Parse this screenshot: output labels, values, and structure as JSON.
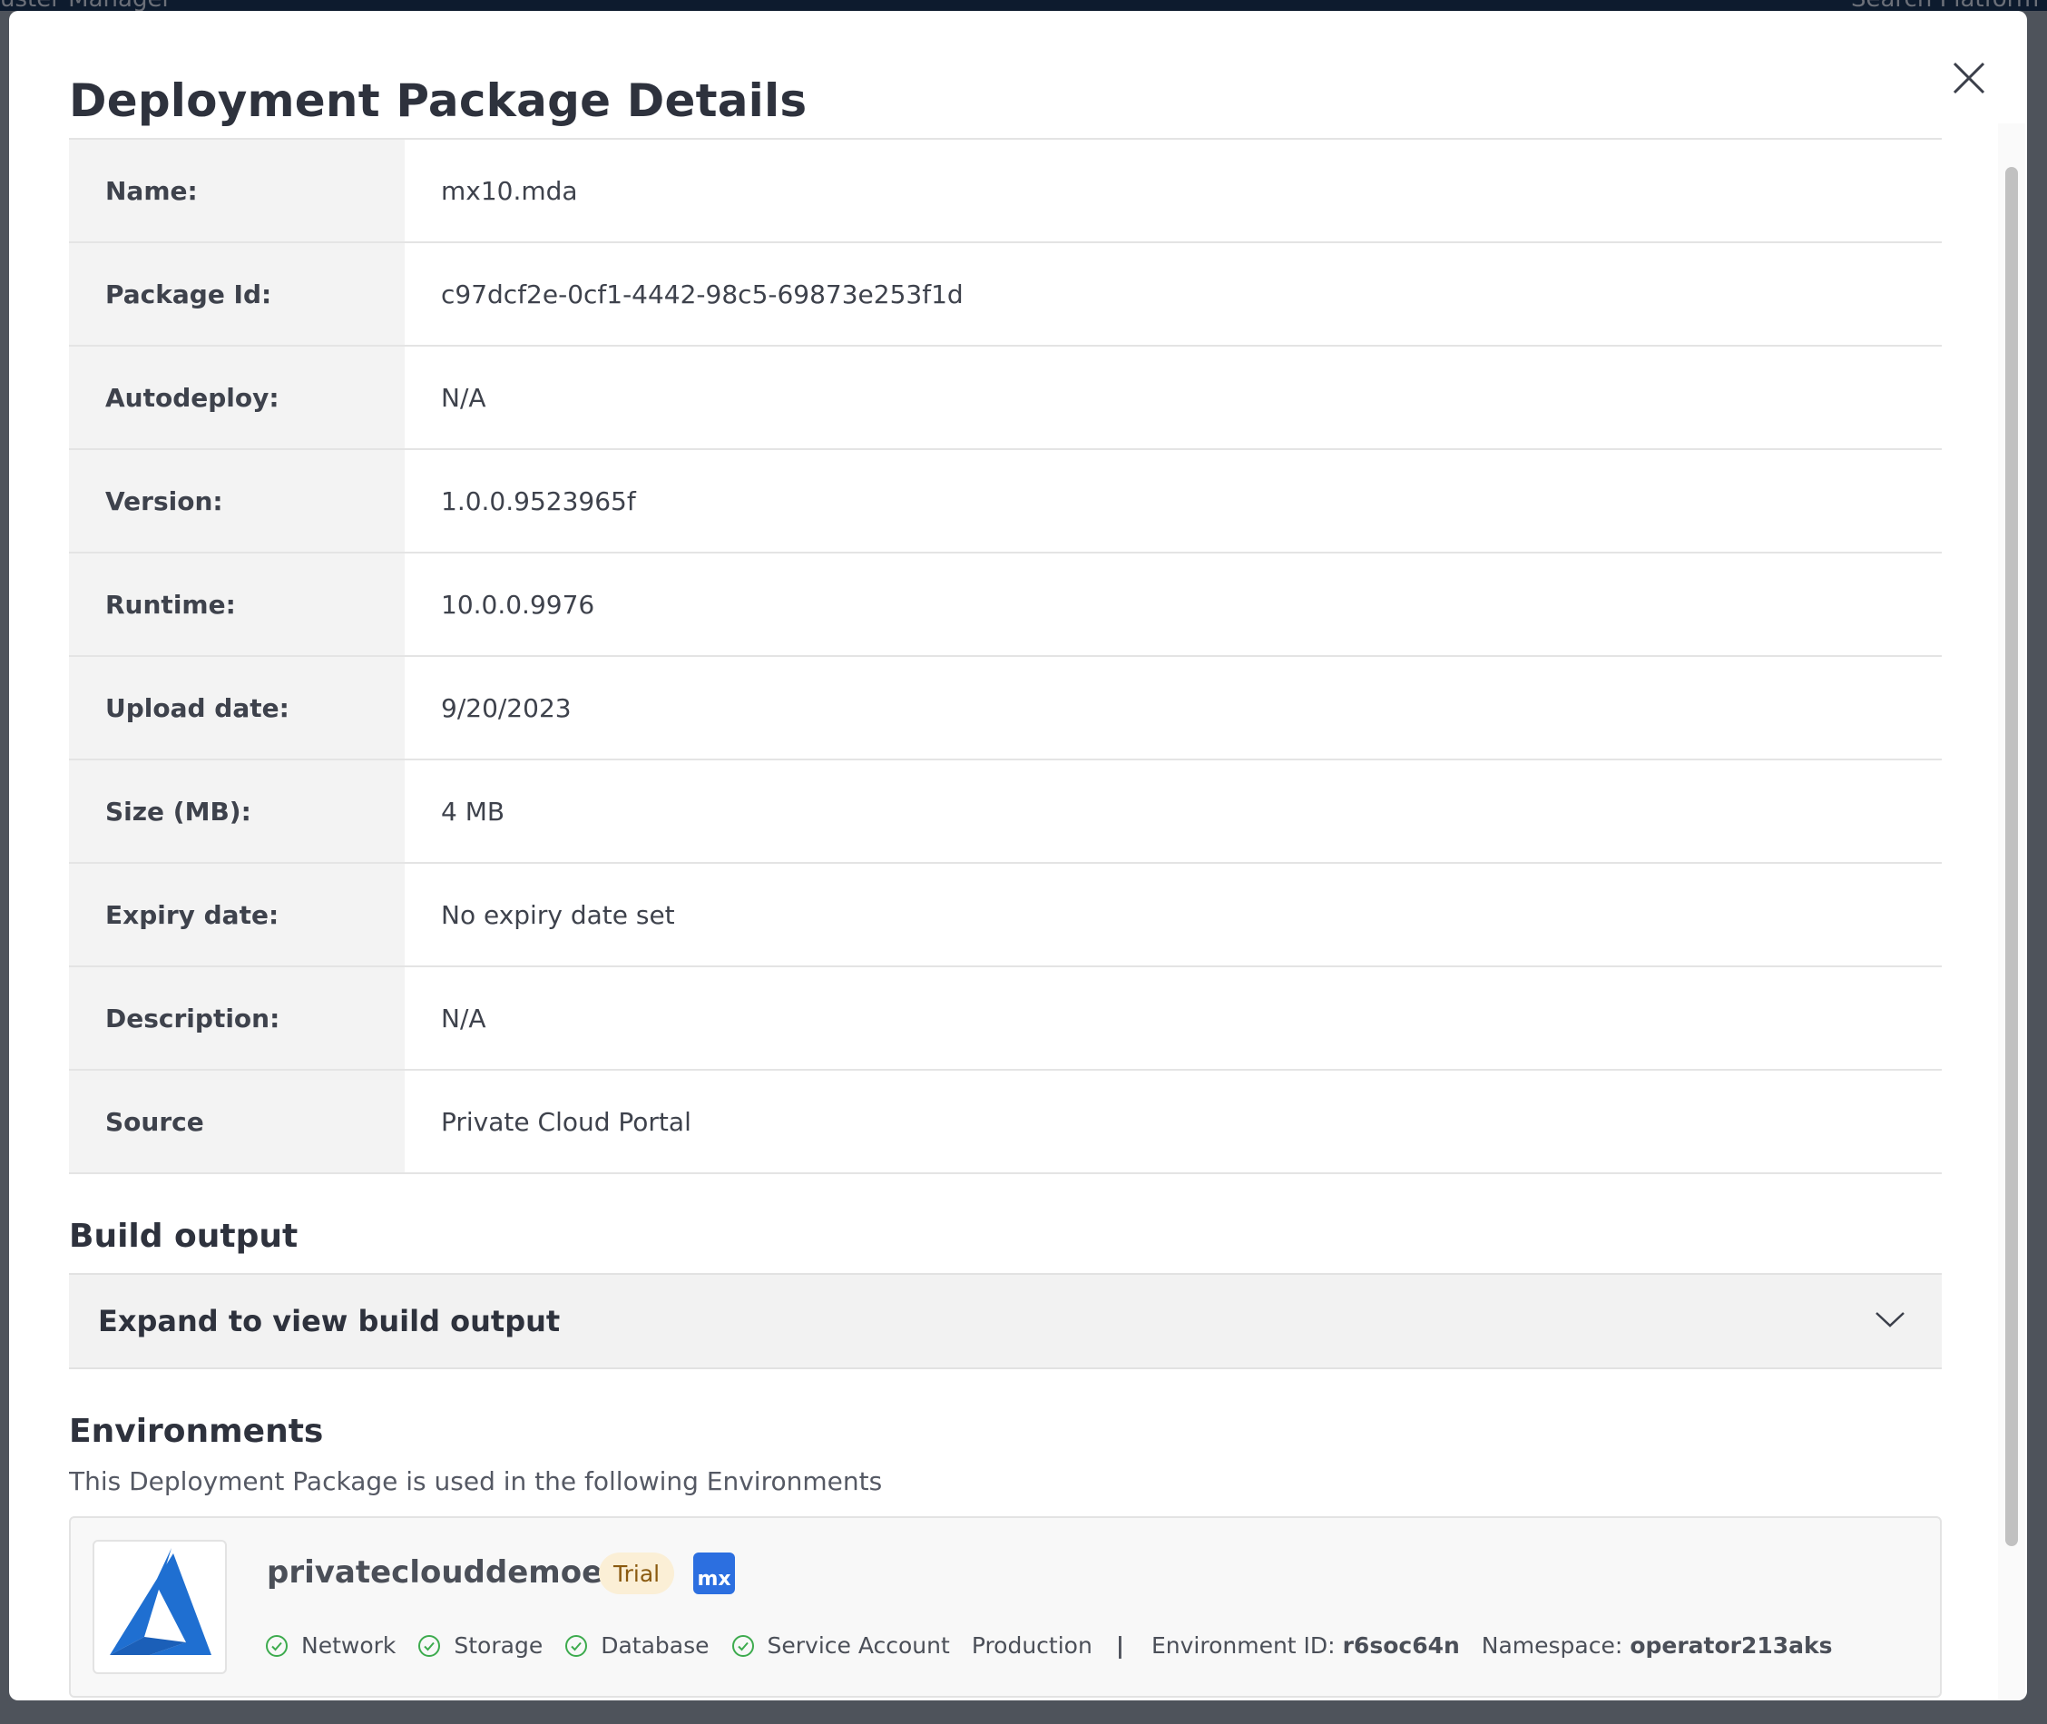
{
  "background": {
    "title": "uster Manager",
    "search_placeholder": "Search Platform"
  },
  "modal": {
    "title": "Deployment Package Details",
    "close_icon": "close-icon"
  },
  "details": [
    {
      "label": "Name:",
      "value": "mx10.mda"
    },
    {
      "label": "Package Id:",
      "value": "c97dcf2e-0cf1-4442-98c5-69873e253f1d"
    },
    {
      "label": "Autodeploy:",
      "value": "N/A"
    },
    {
      "label": "Version:",
      "value": "1.0.0.9523965f"
    },
    {
      "label": "Runtime:",
      "value": "10.0.0.9976"
    },
    {
      "label": "Upload date:",
      "value": "9/20/2023"
    },
    {
      "label": "Size (MB):",
      "value": "4 MB"
    },
    {
      "label": "Expiry date:",
      "value": "No expiry date set"
    },
    {
      "label": "Description:",
      "value": "N/A"
    },
    {
      "label": "Source",
      "value": "Private Cloud Portal"
    }
  ],
  "build_output": {
    "title": "Build output",
    "expander_label": "Expand to view build output",
    "icon": "chevron-down-icon"
  },
  "environments": {
    "title": "Environments",
    "description": "This Deployment Package is used in the following Environments",
    "items": [
      {
        "name": "privateclouddemoenv",
        "badge": "Trial",
        "mx_badge": "mx",
        "logo": "azure-logo",
        "checks": [
          "Network",
          "Storage",
          "Database",
          "Service Account"
        ],
        "type": "Production",
        "separator": "|",
        "env_id_label": "Environment ID:",
        "env_id": "r6soc64n",
        "namespace_label": "Namespace:",
        "namespace": "operator213aks"
      }
    ]
  },
  "colors": {
    "check_green": "#3dab4e",
    "mx_blue": "#2c6fe0",
    "azure_blue": "#1f6fd1",
    "trial_bg": "#fbefd6"
  }
}
